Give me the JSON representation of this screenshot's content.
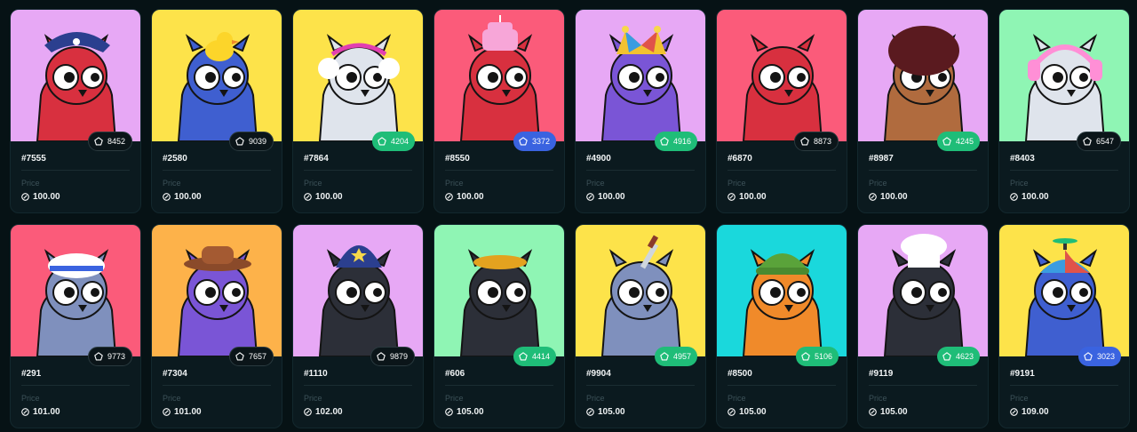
{
  "price_label": "Price",
  "items": [
    {
      "id": "#7555",
      "rank": "8452",
      "price": "100.00",
      "bg": "#e7a8f5",
      "body": "#d8303f",
      "badge": "dark",
      "hat": "pirate"
    },
    {
      "id": "#2580",
      "rank": "9039",
      "price": "100.00",
      "bg": "#fde34a",
      "body": "#3f5fd0",
      "badge": "dark",
      "hat": "duck"
    },
    {
      "id": "#7864",
      "rank": "4204",
      "price": "100.00",
      "bg": "#fde34a",
      "body": "#dfe4ec",
      "badge": "green",
      "hat": "earmuffs"
    },
    {
      "id": "#8550",
      "rank": "3372",
      "price": "100.00",
      "bg": "#fb5b7a",
      "body": "#d8303f",
      "badge": "blue",
      "hat": "cake"
    },
    {
      "id": "#4900",
      "rank": "4916",
      "price": "100.00",
      "bg": "#e7a8f5",
      "body": "#7a55d6",
      "badge": "green",
      "hat": "jester"
    },
    {
      "id": "#6870",
      "rank": "8873",
      "price": "100.00",
      "bg": "#fb5b7a",
      "body": "#d8303f",
      "badge": "dark",
      "hat": "none"
    },
    {
      "id": "#8987",
      "rank": "4245",
      "price": "100.00",
      "bg": "#e7a8f5",
      "body": "#b06b3e",
      "badge": "green",
      "hat": "afro"
    },
    {
      "id": "#8403",
      "rank": "6547",
      "price": "100.00",
      "bg": "#8ff5b4",
      "body": "#dfe4ec",
      "badge": "dark",
      "hat": "headphones"
    },
    {
      "id": "#291",
      "rank": "9773",
      "price": "101.00",
      "bg": "#fb5b7a",
      "body": "#7f90bd",
      "badge": "dark",
      "hat": "sailor"
    },
    {
      "id": "#7304",
      "rank": "7657",
      "price": "101.00",
      "bg": "#fdb24a",
      "body": "#7a55d6",
      "badge": "dark",
      "hat": "cowboy"
    },
    {
      "id": "#1110",
      "rank": "9879",
      "price": "102.00",
      "bg": "#e7a8f5",
      "body": "#2c2f38",
      "badge": "dark",
      "hat": "police"
    },
    {
      "id": "#606",
      "rank": "4414",
      "price": "105.00",
      "bg": "#8ff5b4",
      "body": "#2c2f38",
      "badge": "green",
      "hat": "beret"
    },
    {
      "id": "#9904",
      "rank": "4957",
      "price": "105.00",
      "bg": "#fde34a",
      "body": "#7f90bd",
      "badge": "green",
      "hat": "knife"
    },
    {
      "id": "#8500",
      "rank": "5106",
      "price": "105.00",
      "bg": "#1ad8dc",
      "body": "#f08a2a",
      "badge": "green",
      "hat": "beanie"
    },
    {
      "id": "#9119",
      "rank": "4623",
      "price": "105.00",
      "bg": "#e7a8f5",
      "body": "#2c2f38",
      "badge": "green",
      "hat": "chef"
    },
    {
      "id": "#9191",
      "rank": "3023",
      "price": "109.00",
      "bg": "#fde34a",
      "body": "#3f5fd0",
      "badge": "blue",
      "hat": "propeller"
    }
  ]
}
